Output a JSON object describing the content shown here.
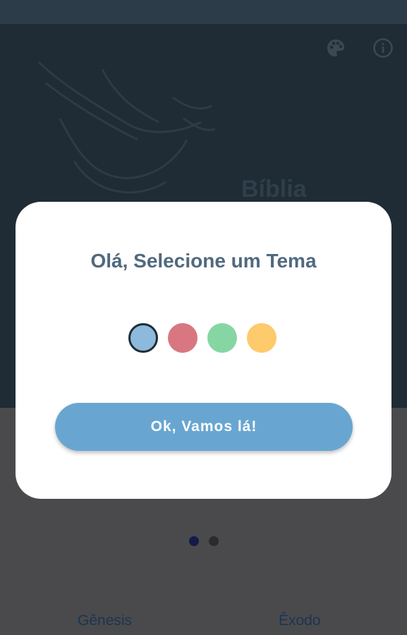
{
  "app": {
    "title": "Bíblia"
  },
  "header": {
    "icons": [
      "palette-icon",
      "info-icon"
    ]
  },
  "modal": {
    "title": "Olá, Selecione um Tema",
    "themes": [
      {
        "name": "blue",
        "color": "#8cb9dc",
        "selected": true
      },
      {
        "name": "red",
        "color": "#d87780",
        "selected": false
      },
      {
        "name": "green",
        "color": "#86d6a4",
        "selected": false
      },
      {
        "name": "yellow",
        "color": "#fdca6c",
        "selected": false
      }
    ],
    "ok_button": "Ok, Vamos lá!"
  },
  "pager": {
    "count": 2,
    "active_index": 0
  },
  "books": [
    {
      "label": "Gênesis"
    },
    {
      "label": "Êxodo"
    }
  ],
  "colors": {
    "status_bar": "#2c3c49",
    "header_bg": "#1f2c35",
    "accent": "#68a6d1",
    "title_text": "#50697f"
  }
}
